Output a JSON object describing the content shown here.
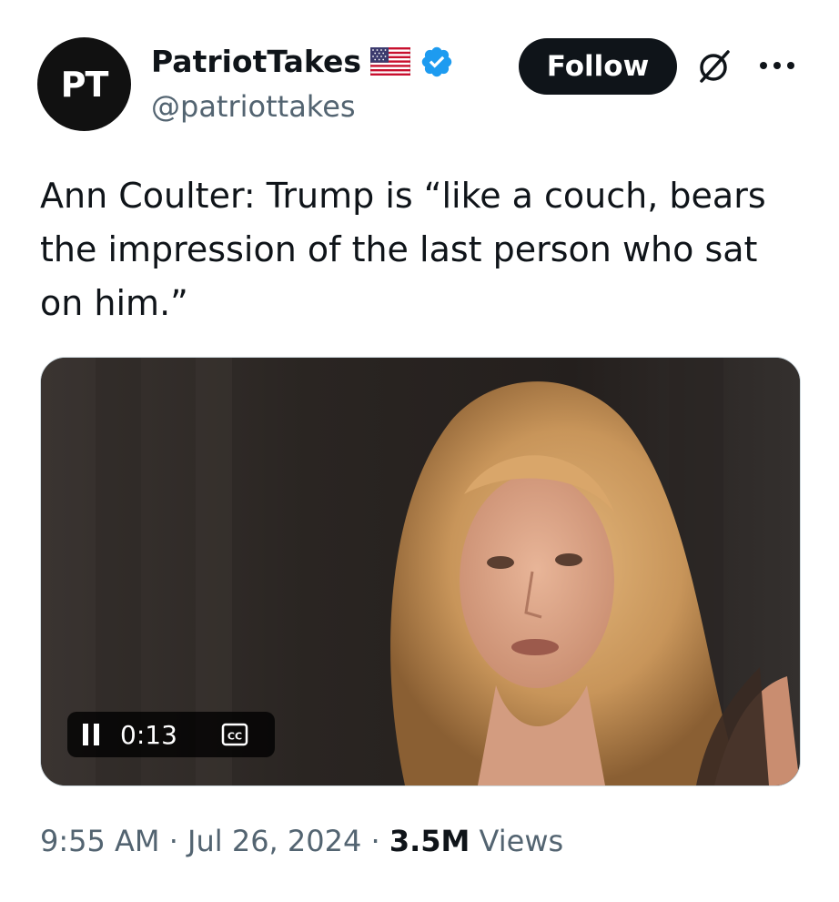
{
  "author": {
    "avatar_text": "PT",
    "display_name": "PatriotTakes",
    "handle": "@patriottakes",
    "flag_icon": "us-flag-icon",
    "verified_icon": "verified-badge-icon"
  },
  "actions": {
    "follow_label": "Follow",
    "grok_icon": "grok-icon",
    "more_icon": "more-options-icon"
  },
  "tweet": {
    "text": "Ann Coulter: Trump is “like a couch, bears the impression of the last person who sat on him.”"
  },
  "video": {
    "elapsed_time": "0:13",
    "pause_icon": "pause-icon",
    "captions_icon": "closed-captions-icon",
    "captions_label": "CC"
  },
  "meta": {
    "time": "9:55 AM",
    "separator": "·",
    "date": "Jul 26, 2024",
    "views_count": "3.5M",
    "views_label": "Views"
  },
  "colors": {
    "verified_blue": "#1d9bf0",
    "text_primary": "#0f1419",
    "text_secondary": "#536471",
    "follow_bg": "#0f1419"
  }
}
